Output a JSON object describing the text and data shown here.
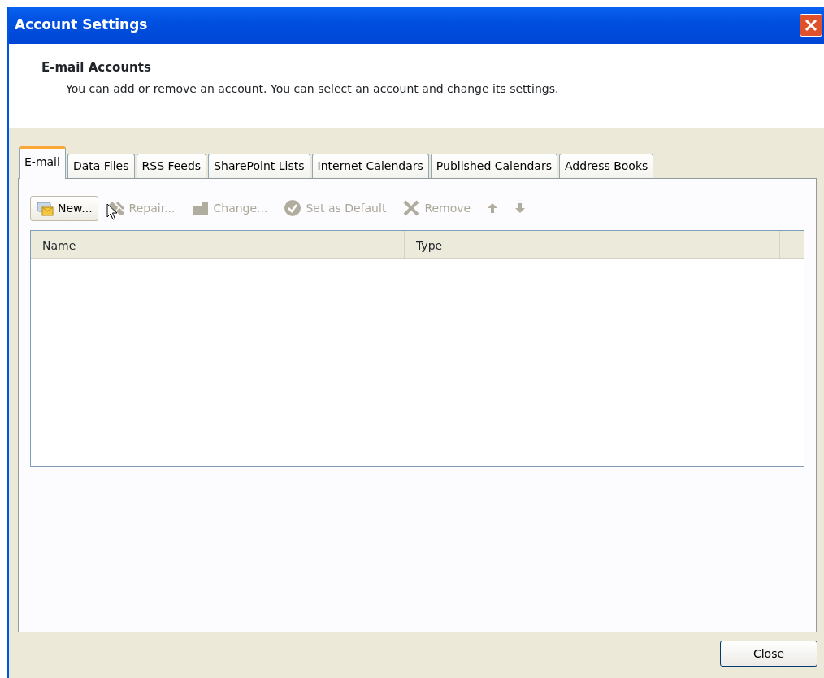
{
  "window": {
    "title": "Account Settings"
  },
  "header": {
    "title": "E-mail Accounts",
    "description": "You can add or remove an account. You can select an account and change its settings."
  },
  "tabs": [
    {
      "label": "E-mail",
      "selected": true
    },
    {
      "label": "Data Files",
      "selected": false
    },
    {
      "label": "RSS Feeds",
      "selected": false
    },
    {
      "label": "SharePoint Lists",
      "selected": false
    },
    {
      "label": "Internet Calendars",
      "selected": false
    },
    {
      "label": "Published Calendars",
      "selected": false
    },
    {
      "label": "Address Books",
      "selected": false
    }
  ],
  "toolbar": [
    {
      "label": "New...",
      "disabled": false,
      "hovered": true
    },
    {
      "label": "Repair...",
      "disabled": true,
      "hovered": false
    },
    {
      "label": "Change...",
      "disabled": true,
      "hovered": false
    },
    {
      "label": "Set as Default",
      "disabled": true,
      "hovered": false
    },
    {
      "label": "Remove",
      "disabled": true,
      "hovered": false
    },
    {
      "disabled": true,
      "hovered": false
    },
    {
      "disabled": true,
      "hovered": false
    }
  ],
  "table": {
    "columns": [
      "Name",
      "Type"
    ]
  },
  "buttons": [
    "Close"
  ]
}
